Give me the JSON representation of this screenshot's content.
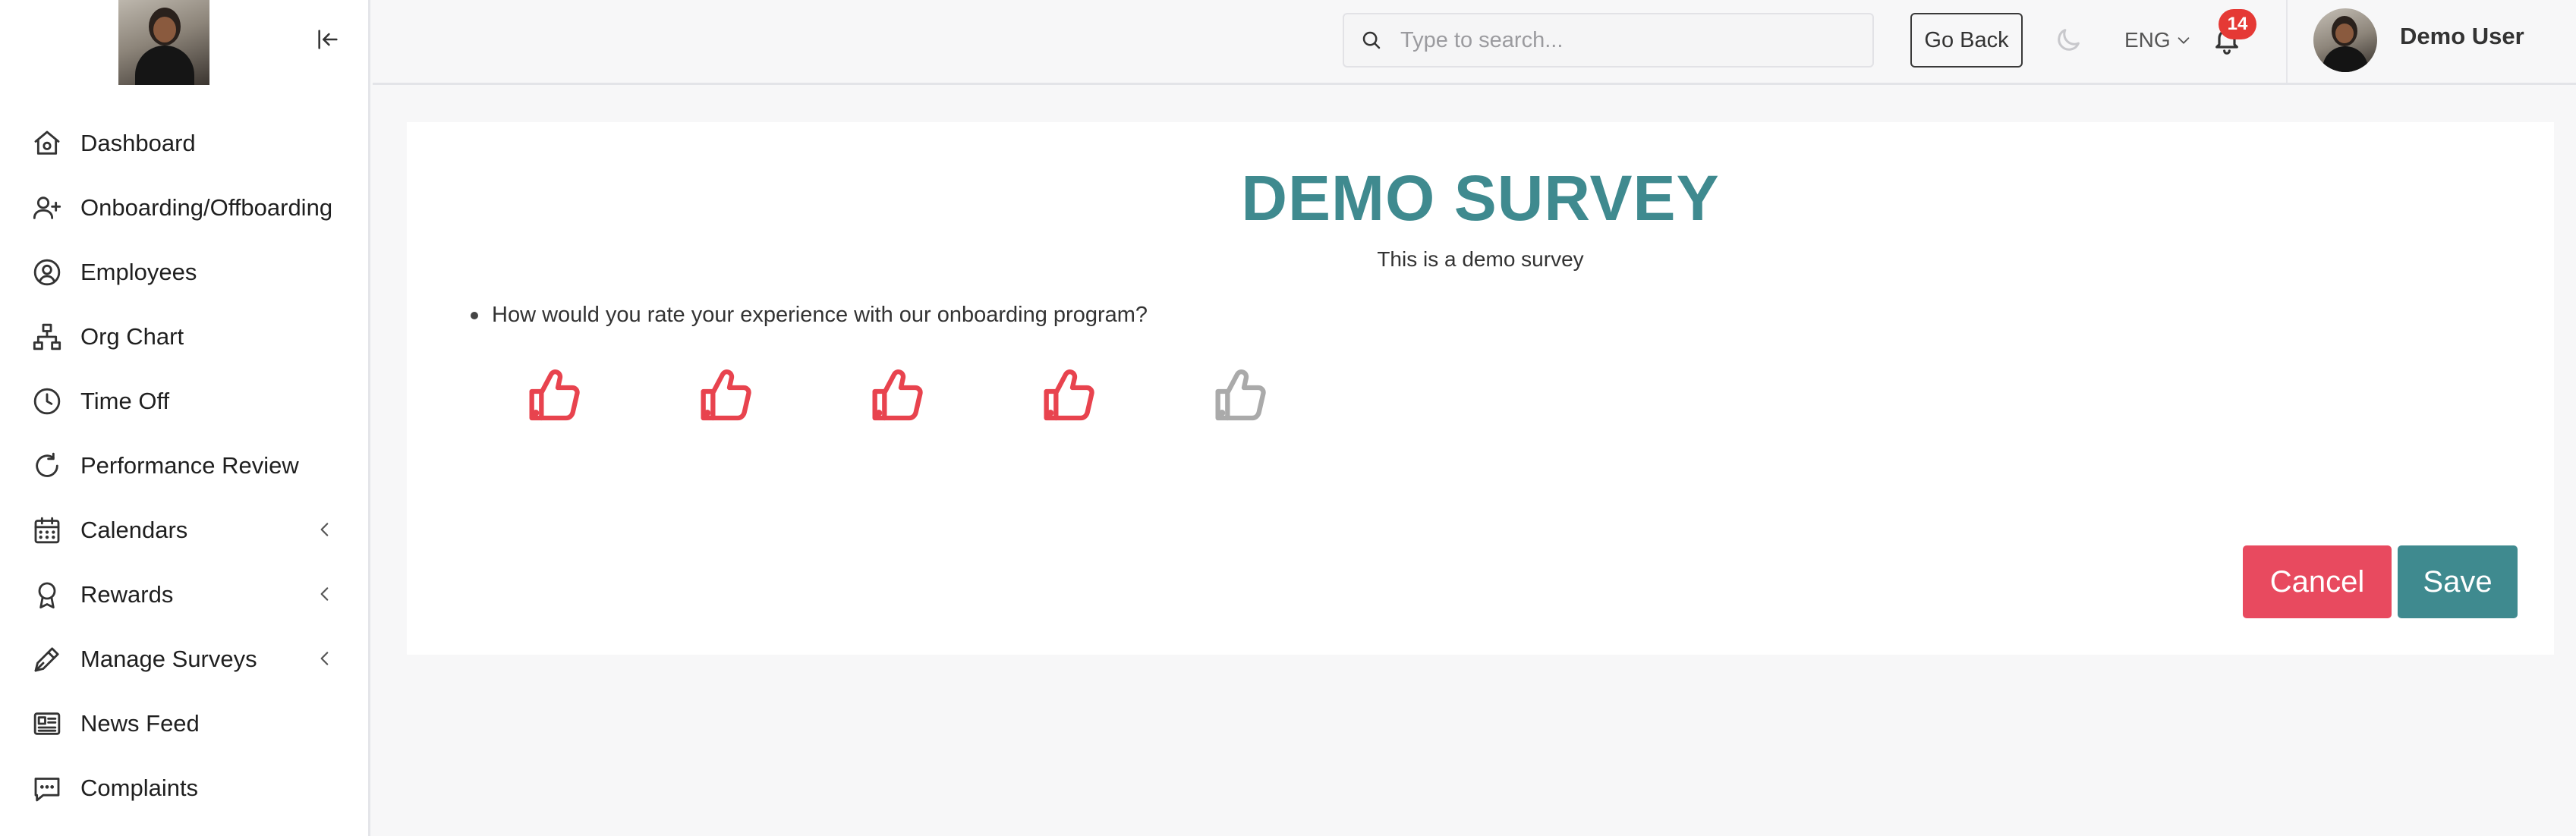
{
  "colors": {
    "accent": "#3f8a8f",
    "danger": "#e84a5f",
    "thumb_active": "#e8434e",
    "thumb_inactive": "#aaaaaa",
    "badge": "#e53935"
  },
  "sidebar": {
    "items": [
      {
        "label": "Dashboard",
        "icon": "home-icon",
        "has_submenu": false
      },
      {
        "label": "Onboarding/Offboarding",
        "icon": "user-plus-icon",
        "has_submenu": false
      },
      {
        "label": "Employees",
        "icon": "user-circle-icon",
        "has_submenu": false
      },
      {
        "label": "Org Chart",
        "icon": "org-chart-icon",
        "has_submenu": false
      },
      {
        "label": "Time Off",
        "icon": "clock-icon",
        "has_submenu": false
      },
      {
        "label": "Performance Review",
        "icon": "refresh-icon",
        "has_submenu": false
      },
      {
        "label": "Calendars",
        "icon": "calendar-icon",
        "has_submenu": true
      },
      {
        "label": "Rewards",
        "icon": "award-icon",
        "has_submenu": true
      },
      {
        "label": "Manage Surveys",
        "icon": "pen-icon",
        "has_submenu": true
      },
      {
        "label": "News Feed",
        "icon": "newspaper-icon",
        "has_submenu": false
      },
      {
        "label": "Complaints",
        "icon": "message-icon",
        "has_submenu": false
      }
    ]
  },
  "header": {
    "search_placeholder": "Type to search...",
    "go_back_label": "Go Back",
    "language": "ENG",
    "notification_count": "14",
    "user_name": "Demo User"
  },
  "survey": {
    "title": "DEMO SURVEY",
    "description": "This is a demo survey",
    "question": "How would you rate your experience with our onboarding program?",
    "rating_max": 5,
    "rating_value": 4,
    "cancel_label": "Cancel",
    "save_label": "Save"
  }
}
